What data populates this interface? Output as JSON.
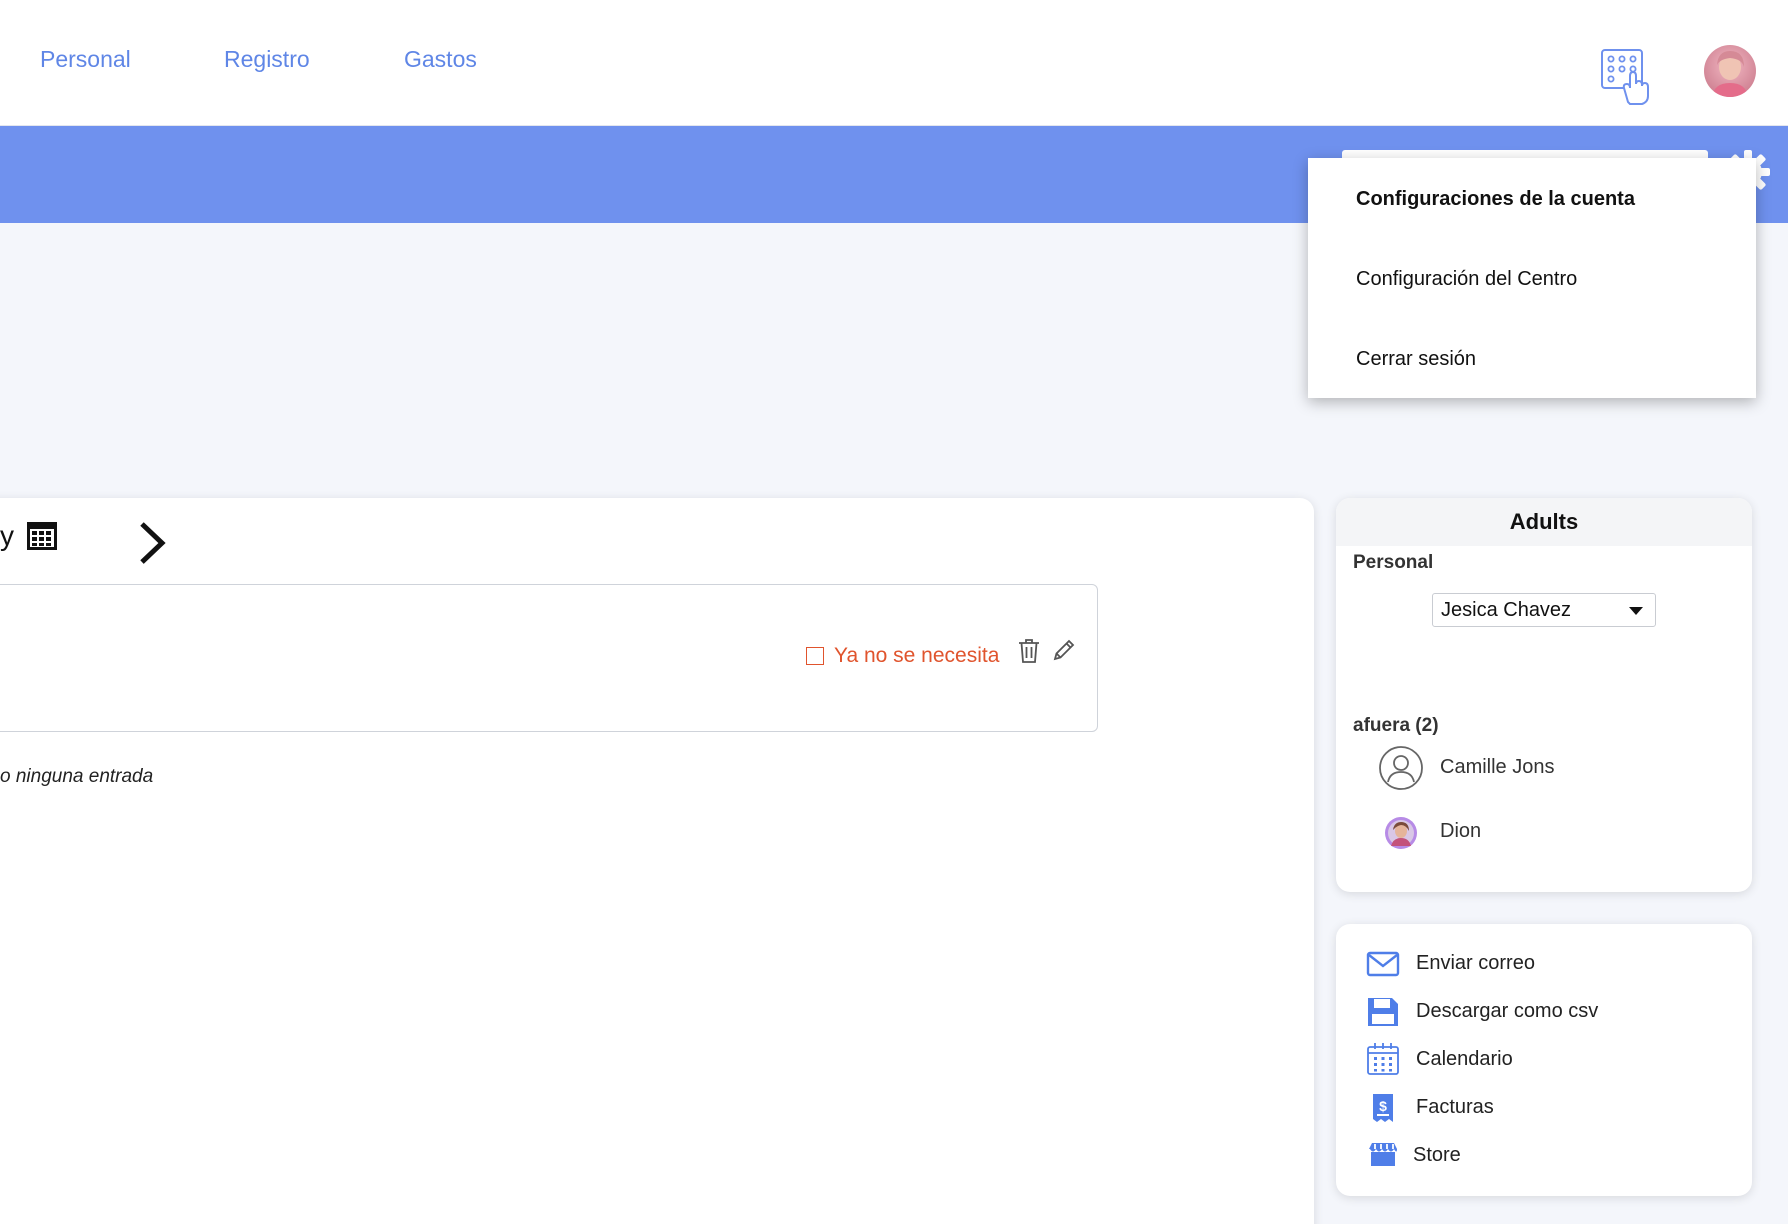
{
  "nav": {
    "links": [
      "Personal",
      "Registro",
      "Gastos"
    ]
  },
  "icons": {
    "kiosk": "kiosk-keypad-icon",
    "gear": "gear-icon",
    "calendar": "calendar-grid-icon",
    "next": "chevron-right-icon",
    "trash": "trash-icon",
    "edit": "pencil-icon"
  },
  "colors": {
    "accent": "#6f91ee",
    "nav_link": "#5f86e6",
    "warning": "#e0542d",
    "icon_blue": "#4f7ee8"
  },
  "dropdown": {
    "items": [
      "Configuraciones de la cuenta",
      "Configuración del Centro",
      "Cerrar sesión"
    ]
  },
  "main": {
    "day_fragment": "y",
    "entry": {
      "no_longer_needed": "Ya no se necesita"
    },
    "no_entry_text": "o ninguna entrada"
  },
  "adults": {
    "title": "Adults",
    "staff_label": "Personal",
    "staff_selected": "Jesica Chavez",
    "out_label": "afuera (2)",
    "people": [
      "Camille Jons",
      "Dion"
    ]
  },
  "actions": {
    "items": [
      "Enviar correo",
      "Descargar como csv",
      "Calendario",
      "Facturas",
      "Store"
    ]
  }
}
